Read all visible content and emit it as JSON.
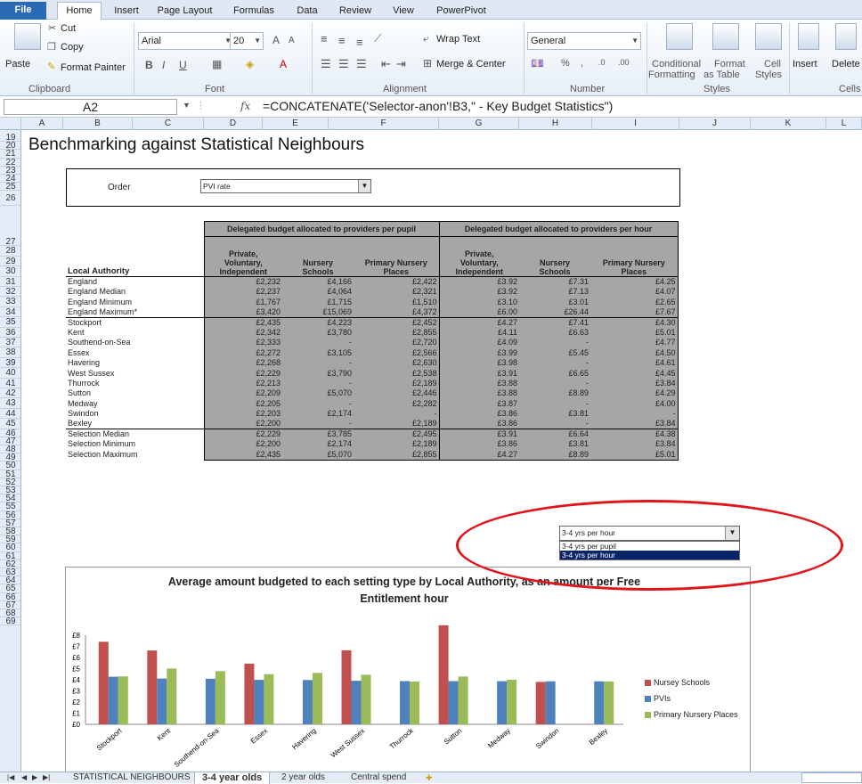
{
  "ribbon_tabs": [
    "File",
    "Home",
    "Insert",
    "Page Layout",
    "Formulas",
    "Data",
    "Review",
    "View",
    "PowerPivot"
  ],
  "clipboard": {
    "paste": "Paste",
    "cut": "Cut",
    "copy": "Copy",
    "format_painter": "Format Painter",
    "label": "Clipboard"
  },
  "font": {
    "name": "Arial",
    "size": "20",
    "label": "Font"
  },
  "alignment": {
    "wrap": "Wrap Text",
    "merge": "Merge & Center",
    "label": "Alignment"
  },
  "number": {
    "format": "General",
    "label": "Number"
  },
  "styles": {
    "conditional": "Conditional",
    "formatting": "Formatting",
    "format_as": "Format",
    "as_table": "as Table",
    "cell": "Cell",
    "cell_styles": "Styles",
    "label": "Styles"
  },
  "cells": {
    "insert": "Insert",
    "delete": "Delete",
    "label": "Cells"
  },
  "namebox": "A2",
  "formula": "=CONCATENATE('Selector-anon'!B3,\" - Key Budget Statistics\")",
  "columns": [
    "A",
    "B",
    "C",
    "D",
    "E",
    "F",
    "G",
    "H",
    "I",
    "J",
    "K",
    "L"
  ],
  "rows": [
    "19",
    "20",
    "21",
    "22",
    "23",
    "24",
    "25",
    "26",
    "27",
    "28",
    "29",
    "30",
    "31",
    "32",
    "33",
    "34",
    "35",
    "36",
    "37",
    "38",
    "39",
    "40",
    "41",
    "42",
    "43",
    "44",
    "45",
    "46",
    "47",
    "48",
    "49",
    "50",
    "51",
    "52",
    "53",
    "54",
    "55",
    "56",
    "57",
    "58",
    "59",
    "60",
    "61",
    "62",
    "63",
    "64",
    "65",
    "66",
    "67",
    "68",
    "69"
  ],
  "title": "Benchmarking against Statistical Neighbours",
  "order": {
    "label": "Order",
    "value": "PVI rate"
  },
  "table": {
    "group1": "Delegated budget allocated to providers per pupil",
    "group2": "Delegated budget allocated to providers per hour",
    "col_la": "Local Authority",
    "col_pvi": [
      "Private,",
      "Voluntary,",
      "Independent"
    ],
    "col_ns": [
      "Nursery",
      "Schools"
    ],
    "col_pnp": [
      "Primary Nursery",
      "Places"
    ],
    "rows": [
      [
        "England",
        "£2,232",
        "£4,166",
        "£2,422",
        "£3.92",
        "£7.31",
        "£4.25"
      ],
      [
        "England Median",
        "£2,237",
        "£4,064",
        "£2,321",
        "£3.92",
        "£7.13",
        "£4.07"
      ],
      [
        "England Minimum",
        "£1,767",
        "£1,715",
        "£1,510",
        "£3.10",
        "£3.01",
        "£2.65"
      ],
      [
        "England Maximum*",
        "£3,420",
        "£15,069",
        "£4,372",
        "£6.00",
        "£26.44",
        "£7.67"
      ],
      [
        "Stockport",
        "£2,435",
        "£4,223",
        "£2,452",
        "£4.27",
        "£7.41",
        "£4.30"
      ],
      [
        "Kent",
        "£2,342",
        "£3,780",
        "£2,855",
        "£4.11",
        "£6.63",
        "£5.01"
      ],
      [
        "Southend-on-Sea",
        "£2,333",
        "-",
        "£2,720",
        "£4.09",
        "-",
        "£4.77"
      ],
      [
        "Essex",
        "£2,272",
        "£3,105",
        "£2,566",
        "£3.99",
        "£5.45",
        "£4.50"
      ],
      [
        "Havering",
        "£2,268",
        "-",
        "£2,630",
        "£3.98",
        "-",
        "£4.61"
      ],
      [
        "West Sussex",
        "£2,229",
        "£3,790",
        "£2,538",
        "£3.91",
        "£6.65",
        "£4.45"
      ],
      [
        "Thurrock",
        "£2,213",
        "-",
        "£2,189",
        "£3.88",
        "-",
        "£3.84"
      ],
      [
        "Sutton",
        "£2,209",
        "£5,070",
        "£2,446",
        "£3.88",
        "£8.89",
        "£4.29"
      ],
      [
        "Medway",
        "£2,205",
        "-",
        "£2,282",
        "£3.87",
        "-",
        "£4.00"
      ],
      [
        "Swindon",
        "£2,203",
        "£2,174",
        "-",
        "£3.86",
        "£3.81",
        "-"
      ],
      [
        "Bexley",
        "£2,200",
        "-",
        "£2,189",
        "£3.86",
        "-",
        "£3.84"
      ],
      [
        "Selection Median",
        "£2,229",
        "£3,785",
        "£2,495",
        "£3.91",
        "£6.64",
        "£4.38"
      ],
      [
        "Selection Minimum",
        "£2,200",
        "£2,174",
        "£2,189",
        "£3.86",
        "£3.81",
        "£3.84"
      ],
      [
        "Selection Maximum",
        "£2,435",
        "£5,070",
        "£2,855",
        "£4.27",
        "£8.89",
        "£5.01"
      ]
    ]
  },
  "dropdown2": {
    "value": "3-4 yrs per hour",
    "options": [
      "3-4 yrs per pupil",
      "3-4 yrs per hour"
    ],
    "selected": 1
  },
  "chart_data": {
    "type": "bar",
    "title": "Average amount budgeted to each setting type by Local Authority, as an amount per Free Entitlement hour",
    "categories": [
      "Stockport",
      "Kent",
      "Southend-on-Sea",
      "Essex",
      "Havering",
      "West Sussex",
      "Thurrock",
      "Sutton",
      "Medway",
      "Swindon",
      "Bexley"
    ],
    "series": [
      {
        "name": "Nursey Schools",
        "color": "#c0504d",
        "values": [
          7.41,
          6.63,
          null,
          5.45,
          null,
          6.65,
          null,
          8.89,
          null,
          3.81,
          null
        ]
      },
      {
        "name": "PVIs",
        "color": "#4f81bd",
        "values": [
          4.27,
          4.11,
          4.09,
          3.99,
          3.98,
          3.91,
          3.88,
          3.88,
          3.87,
          3.86,
          3.86
        ]
      },
      {
        "name": "Primary Nursery Places",
        "color": "#9bbb59",
        "values": [
          4.3,
          5.01,
          4.77,
          4.5,
          4.61,
          4.45,
          3.84,
          4.29,
          4.0,
          null,
          3.84
        ]
      }
    ],
    "yticks": [
      "£0",
      "£1",
      "£2",
      "£3",
      "£4",
      "£5",
      "£6",
      "£7",
      "£8"
    ],
    "ylim": [
      0,
      8
    ]
  },
  "sheet_tabs": [
    "STATISTICAL NEIGHBOURS",
    "3-4 year olds",
    "2 year olds",
    "Central spend"
  ],
  "active_sheet": 1
}
